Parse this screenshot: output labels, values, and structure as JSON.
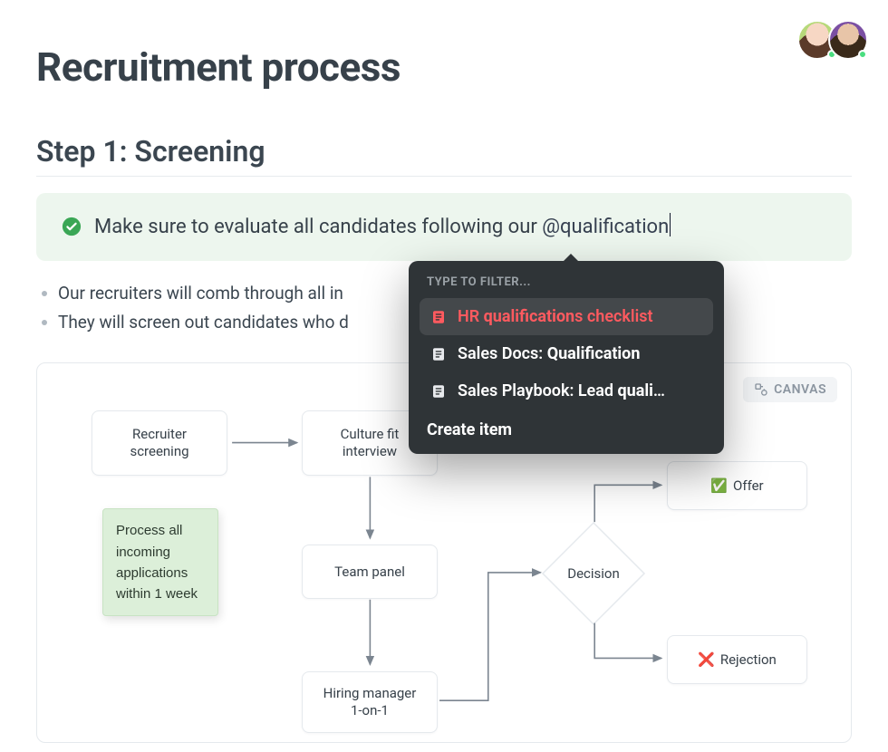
{
  "header": {
    "avatars": [
      {
        "bg": "#b7d97a",
        "presence": true
      },
      {
        "bg": "#7b4fa3",
        "presence": true
      }
    ]
  },
  "page": {
    "title": "Recruitment process",
    "section_title": "Step 1: Screening"
  },
  "callout": {
    "text_prefix": "Make sure to evaluate all candidates following our ",
    "mention": "@qualification"
  },
  "bullets": [
    "Our recruiters will comb through all in",
    "They will screen out candidates who d"
  ],
  "autocomplete": {
    "header": "TYPE TO FILTER...",
    "items": [
      {
        "pre": "HR ",
        "bold": "qualification",
        "post": "s checklist",
        "selected": true
      },
      {
        "pre": "Sales Docs: ",
        "bold": "Qualification",
        "post": "",
        "selected": false
      },
      {
        "pre": "Sales Playbook: Lead ",
        "bold": "quali",
        "post": "…",
        "selected": false
      }
    ],
    "create_label": "Create item"
  },
  "canvas": {
    "badge": "CANVAS",
    "nodes": {
      "recruiter_screening": "Recruiter\nscreening",
      "culture_fit": "Culture fit\ninterview",
      "team_panel": "Team panel",
      "hiring_manager": "Hiring manager\n1-on-1",
      "decision": "Decision",
      "offer": "Offer",
      "rejection": "Rejection"
    },
    "sticky": "Process all\nincoming\napplications\nwithin 1 week",
    "offer_emoji": "✅",
    "rejection_emoji": "❌"
  }
}
